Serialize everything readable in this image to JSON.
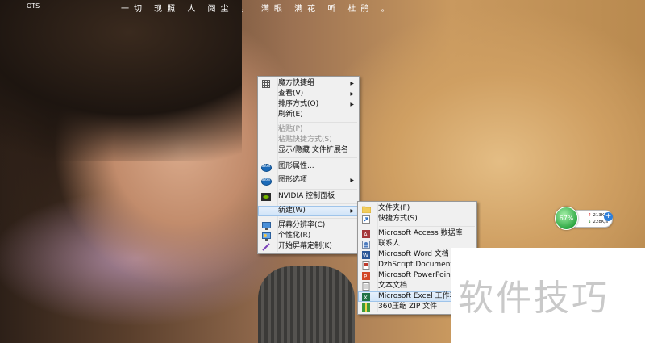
{
  "desktop": {
    "top_left_text": "OTS",
    "quote": "一切 现照 人 阅尘 ，  满眼 满花 听 杜鹃 。"
  },
  "context_menu": {
    "items": [
      {
        "label": "魔方快捷组",
        "icon": "grid-icon",
        "submenu": true
      },
      {
        "label": "查看(V)",
        "submenu": true
      },
      {
        "label": "排序方式(O)",
        "submenu": true
      },
      {
        "label": "刷新(E)"
      },
      {
        "label": "粘贴(P)",
        "disabled": true
      },
      {
        "label": "粘贴快捷方式(S)",
        "disabled": true
      },
      {
        "label": "显示/隐藏 文件扩展名"
      },
      {
        "label": "图形属性...",
        "icon": "intel-icon"
      },
      {
        "label": "图形选项",
        "icon": "intel-icon",
        "submenu": true
      },
      {
        "label": "NVIDIA 控制面板",
        "icon": "nvidia-icon"
      },
      {
        "label": "新建(W)",
        "submenu": true,
        "highlighted": true
      },
      {
        "label": "屏幕分辨率(C)",
        "icon": "monitor-icon"
      },
      {
        "label": "个性化(R)",
        "icon": "personalize-icon"
      },
      {
        "label": "开始屏幕定制(K)",
        "icon": "pen-icon"
      }
    ]
  },
  "new_submenu": {
    "items": [
      {
        "label": "文件夹(F)",
        "icon": "folder-icon"
      },
      {
        "label": "快捷方式(S)",
        "icon": "shortcut-icon"
      },
      {
        "label": "Microsoft Access 数据库",
        "icon": "access-icon"
      },
      {
        "label": "联系人",
        "icon": "contact-icon"
      },
      {
        "label": "Microsoft Word 文档",
        "icon": "word-icon"
      },
      {
        "label": "DzhScript.Document",
        "icon": "document-icon"
      },
      {
        "label": "Microsoft PowerPoint 演示文",
        "icon": "powerpoint-icon"
      },
      {
        "label": "文本文档",
        "icon": "text-document-icon"
      },
      {
        "label": "Microsoft Excel 工作表",
        "icon": "excel-icon",
        "highlighted": true
      },
      {
        "label": "360压缩 ZIP 文件",
        "icon": "zip-icon"
      }
    ]
  },
  "network_widget": {
    "percent": "67%",
    "upload": "213K/s",
    "download": "228K/s"
  },
  "watermark": "软件技巧"
}
